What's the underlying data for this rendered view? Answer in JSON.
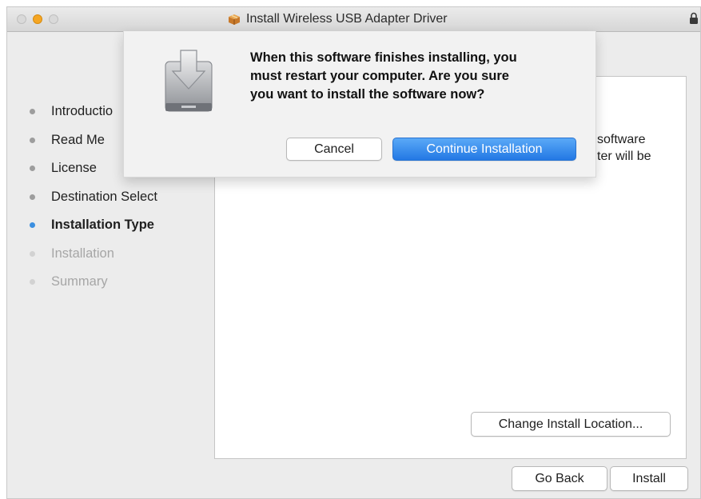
{
  "window": {
    "title": "Install Wireless USB Adapter Driver"
  },
  "sidebar": {
    "items": [
      {
        "label": "Introductio",
        "state": "done"
      },
      {
        "label": "Read Me",
        "state": "done"
      },
      {
        "label": "License",
        "state": "done"
      },
      {
        "label": "Destination Select",
        "state": "done"
      },
      {
        "label": "Installation Type",
        "state": "active"
      },
      {
        "label": "Installation",
        "state": "future"
      },
      {
        "label": "Summary",
        "state": "future"
      }
    ]
  },
  "content": {
    "line1": "software",
    "line2": "ter will be",
    "change_location_label": "Change Install Location..."
  },
  "footer": {
    "back_label": "Go Back",
    "install_label": "Install"
  },
  "dialog": {
    "line1": "When this software finishes installing, you",
    "line2": "must restart your computer. Are you sure",
    "line3": "you want to install the software now?",
    "cancel_label": "Cancel",
    "continue_label": "Continue Installation"
  },
  "colors": {
    "accent": "#3b8fe0",
    "primary_button": "#2378e4",
    "minimize": "#f5a623"
  },
  "icons": [
    "package-icon",
    "lock-icon",
    "disk-install-icon"
  ]
}
